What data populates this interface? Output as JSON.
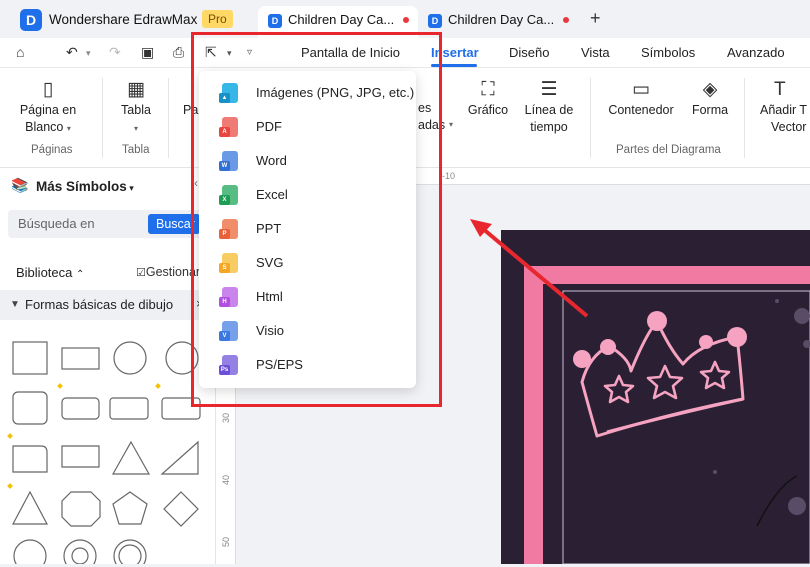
{
  "titlebar": {
    "app_name": "Wondershare EdrawMax",
    "pro_badge": "Pro",
    "tabs": [
      {
        "label": "Children Day Ca...",
        "active": true
      },
      {
        "label": "Children Day Ca...",
        "active": false
      }
    ],
    "new_tab": "+"
  },
  "menubar": {
    "items": [
      "Pantalla de Inicio",
      "Insertar",
      "Diseño",
      "Vista",
      "Símbolos",
      "Avanzado"
    ],
    "active": "Insertar"
  },
  "ribbon": {
    "pagina_line1": "Página en",
    "pagina_line2": "Blanco",
    "tabla": "Tabla",
    "partial_pa": "Pa",
    "partial_es": "es",
    "partial_adas": "adas",
    "grafico": "Gráfico",
    "linea_line1": "Línea de",
    "linea_line2": "tiempo",
    "contenedor": "Contenedor",
    "forma": "Forma",
    "anadir_line1": "Añadir T",
    "anadir_line2": "Vector",
    "group_paginas": "Páginas",
    "group_tabla": "Tabla",
    "group_partes": "Partes del Diagrama"
  },
  "sidebar": {
    "title": "Más Símbolos",
    "search_placeholder": "Búsqueda en",
    "search_button": "Buscar",
    "library_label": "Biblioteca",
    "manage_label": "Gestionar",
    "category": "Formas básicas de dibujo"
  },
  "ruler": {
    "top_tick": "-10",
    "left_ticks": [
      "30",
      "40",
      "50"
    ]
  },
  "export_menu": {
    "items": [
      {
        "label": "Imágenes (PNG, JPG, etc.)",
        "icon": "image-file-icon",
        "color": "#36b7e8"
      },
      {
        "label": "PDF",
        "icon": "pdf-file-icon",
        "color": "#e8463f"
      },
      {
        "label": "Word",
        "icon": "word-file-icon",
        "color": "#2f6fd6"
      },
      {
        "label": "Excel",
        "icon": "excel-file-icon",
        "color": "#1f9d55"
      },
      {
        "label": "PPT",
        "icon": "ppt-file-icon",
        "color": "#e8613a"
      },
      {
        "label": "SVG",
        "icon": "svg-file-icon",
        "color": "#f5b82e"
      },
      {
        "label": "Html",
        "icon": "html-file-icon",
        "color": "#b04fe0"
      },
      {
        "label": "Visio",
        "icon": "visio-file-icon",
        "color": "#3b78e0"
      },
      {
        "label": "PS/EPS",
        "icon": "ps-eps-file-icon",
        "color": "#6c4fd8"
      }
    ]
  },
  "colors": {
    "accent": "#1f6feb",
    "highlight_red": "#e8262d",
    "canvas_dark": "#2a1f33",
    "canvas_pink": "#f07aa2"
  }
}
